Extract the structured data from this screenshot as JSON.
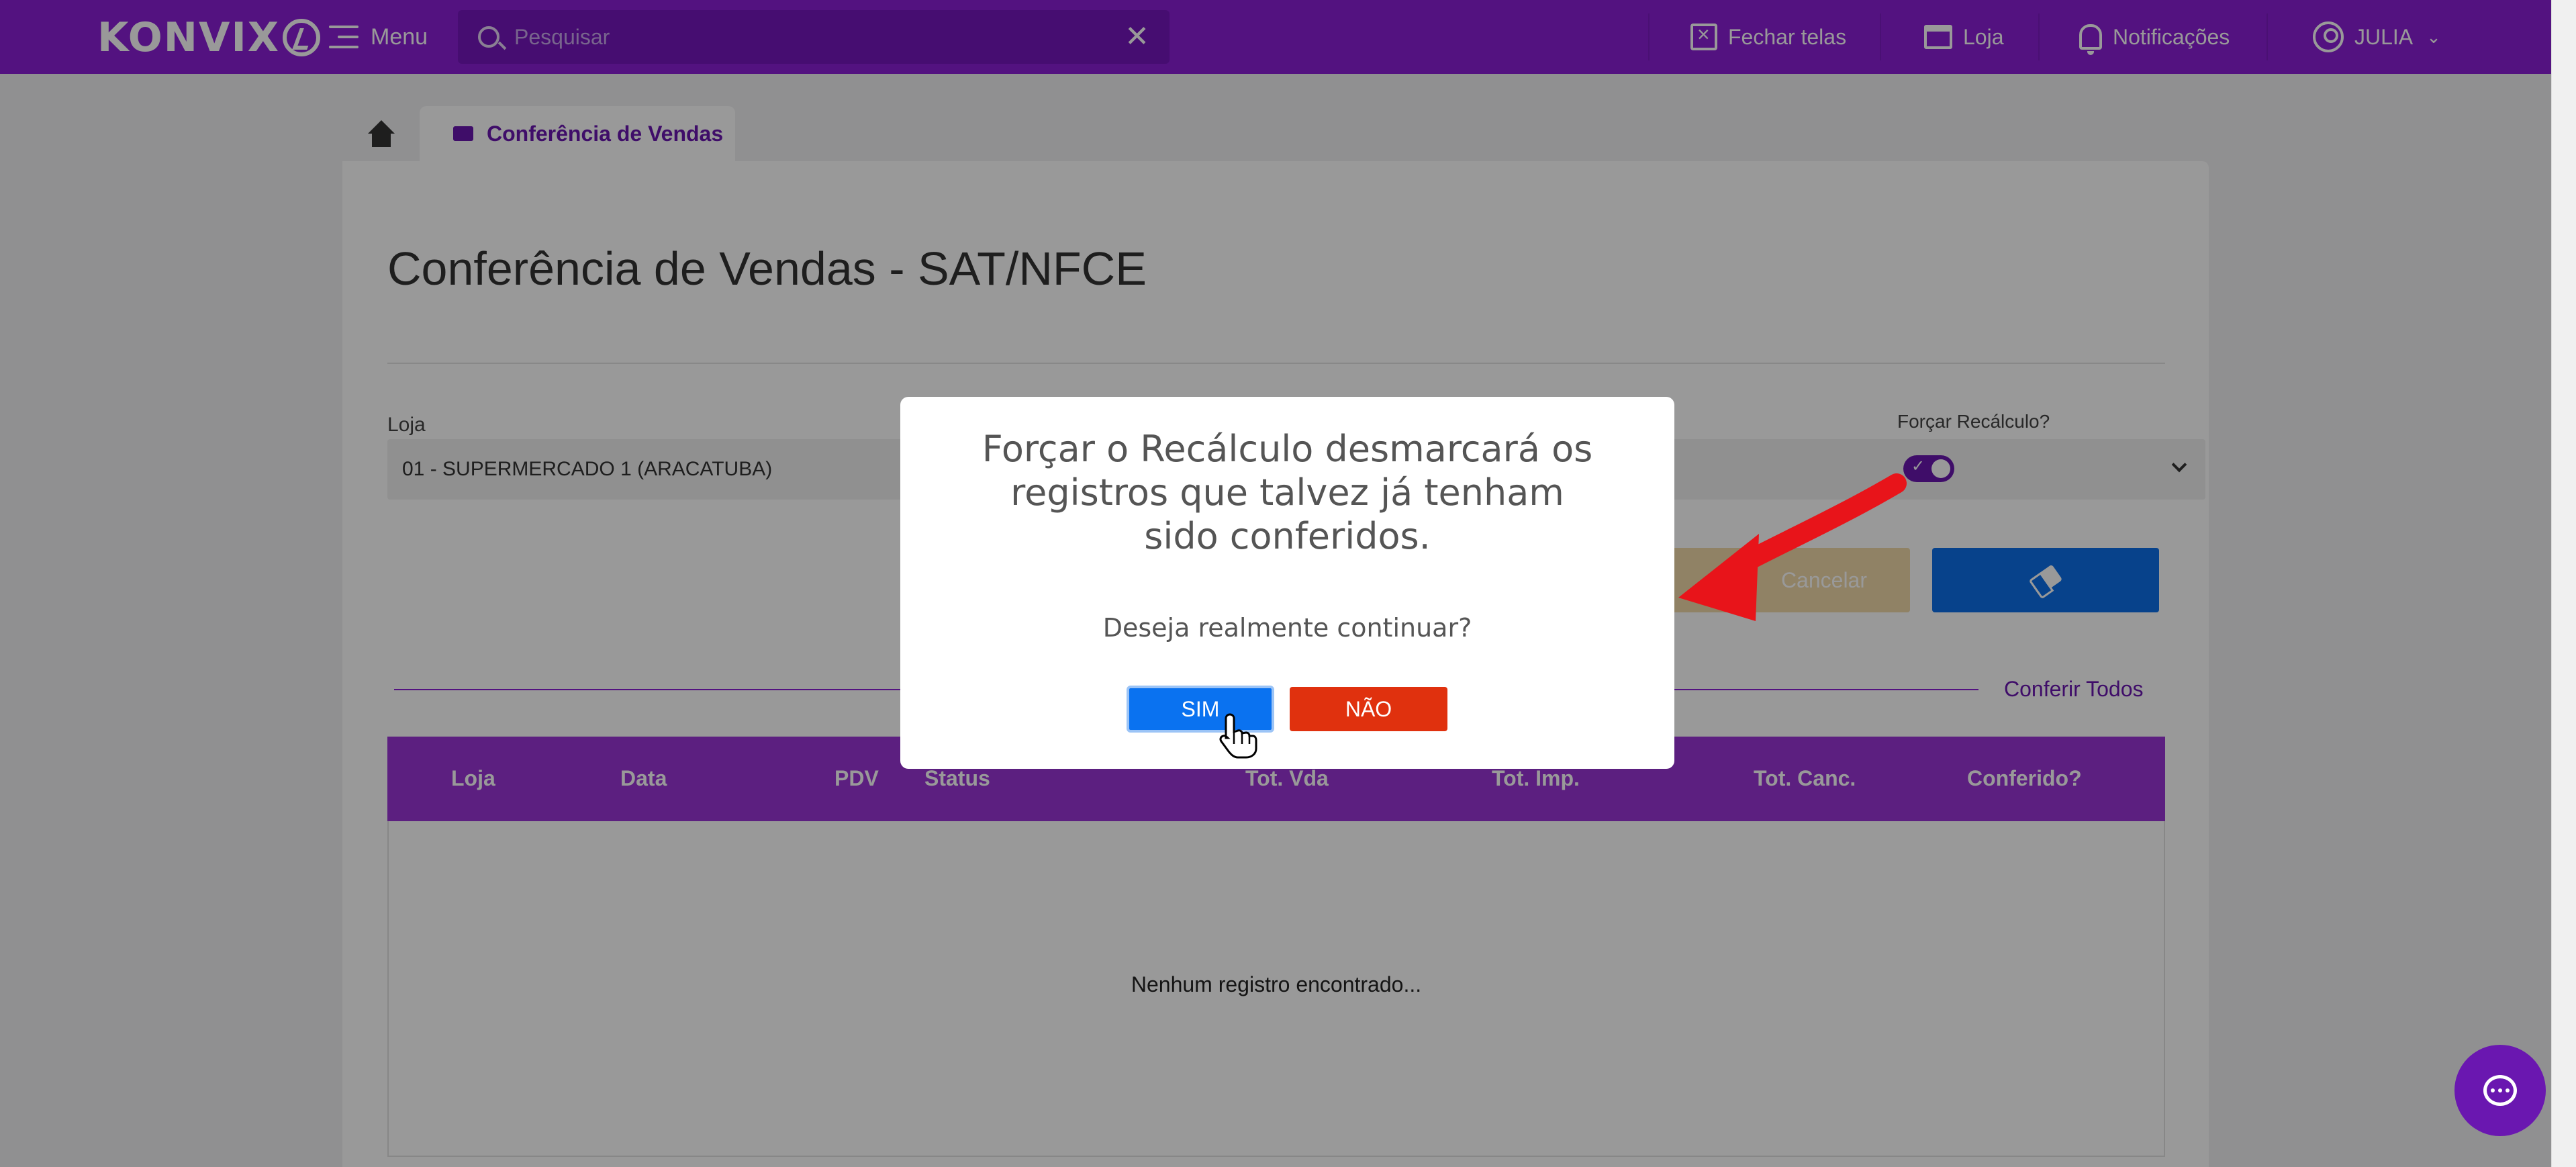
{
  "topbar": {
    "logo": "KONVIX",
    "menu_label": "Menu",
    "search_placeholder": "Pesquisar",
    "fechar_telas": "Fechar telas",
    "loja": "Loja",
    "notificacoes": "Notificações",
    "user": "JULIA"
  },
  "tabs": {
    "active_label": "Conferência de Vendas"
  },
  "page": {
    "title": "Conferência de Vendas - SAT/NFCE",
    "loja_label": "Loja",
    "loja_value": "01 - SUPERMERCADO 1 (ARACATUBA)",
    "forcar_label": "Forçar Recálculo?",
    "cancel_label": "Cancelar",
    "conferir_todos": "Conferir Todos",
    "columns": [
      "Loja",
      "Data",
      "PDV",
      "Status",
      "Tot. Vda",
      "Tot. Imp.",
      "Tot. Canc.",
      "Conferido?"
    ],
    "empty_message": "Nenhum registro encontrado..."
  },
  "modal": {
    "title": "Forçar o Recálculo desmarcará os registros que talvez já tenham sido conferidos.",
    "text": "Deseja realmente continuar?",
    "yes": "SIM",
    "no": "NÃO"
  },
  "colors": {
    "brand_purple": "#8a1fd6",
    "primary_blue": "#0a72f0",
    "danger_red": "#e0310e",
    "arrow_red": "#e8141a"
  }
}
